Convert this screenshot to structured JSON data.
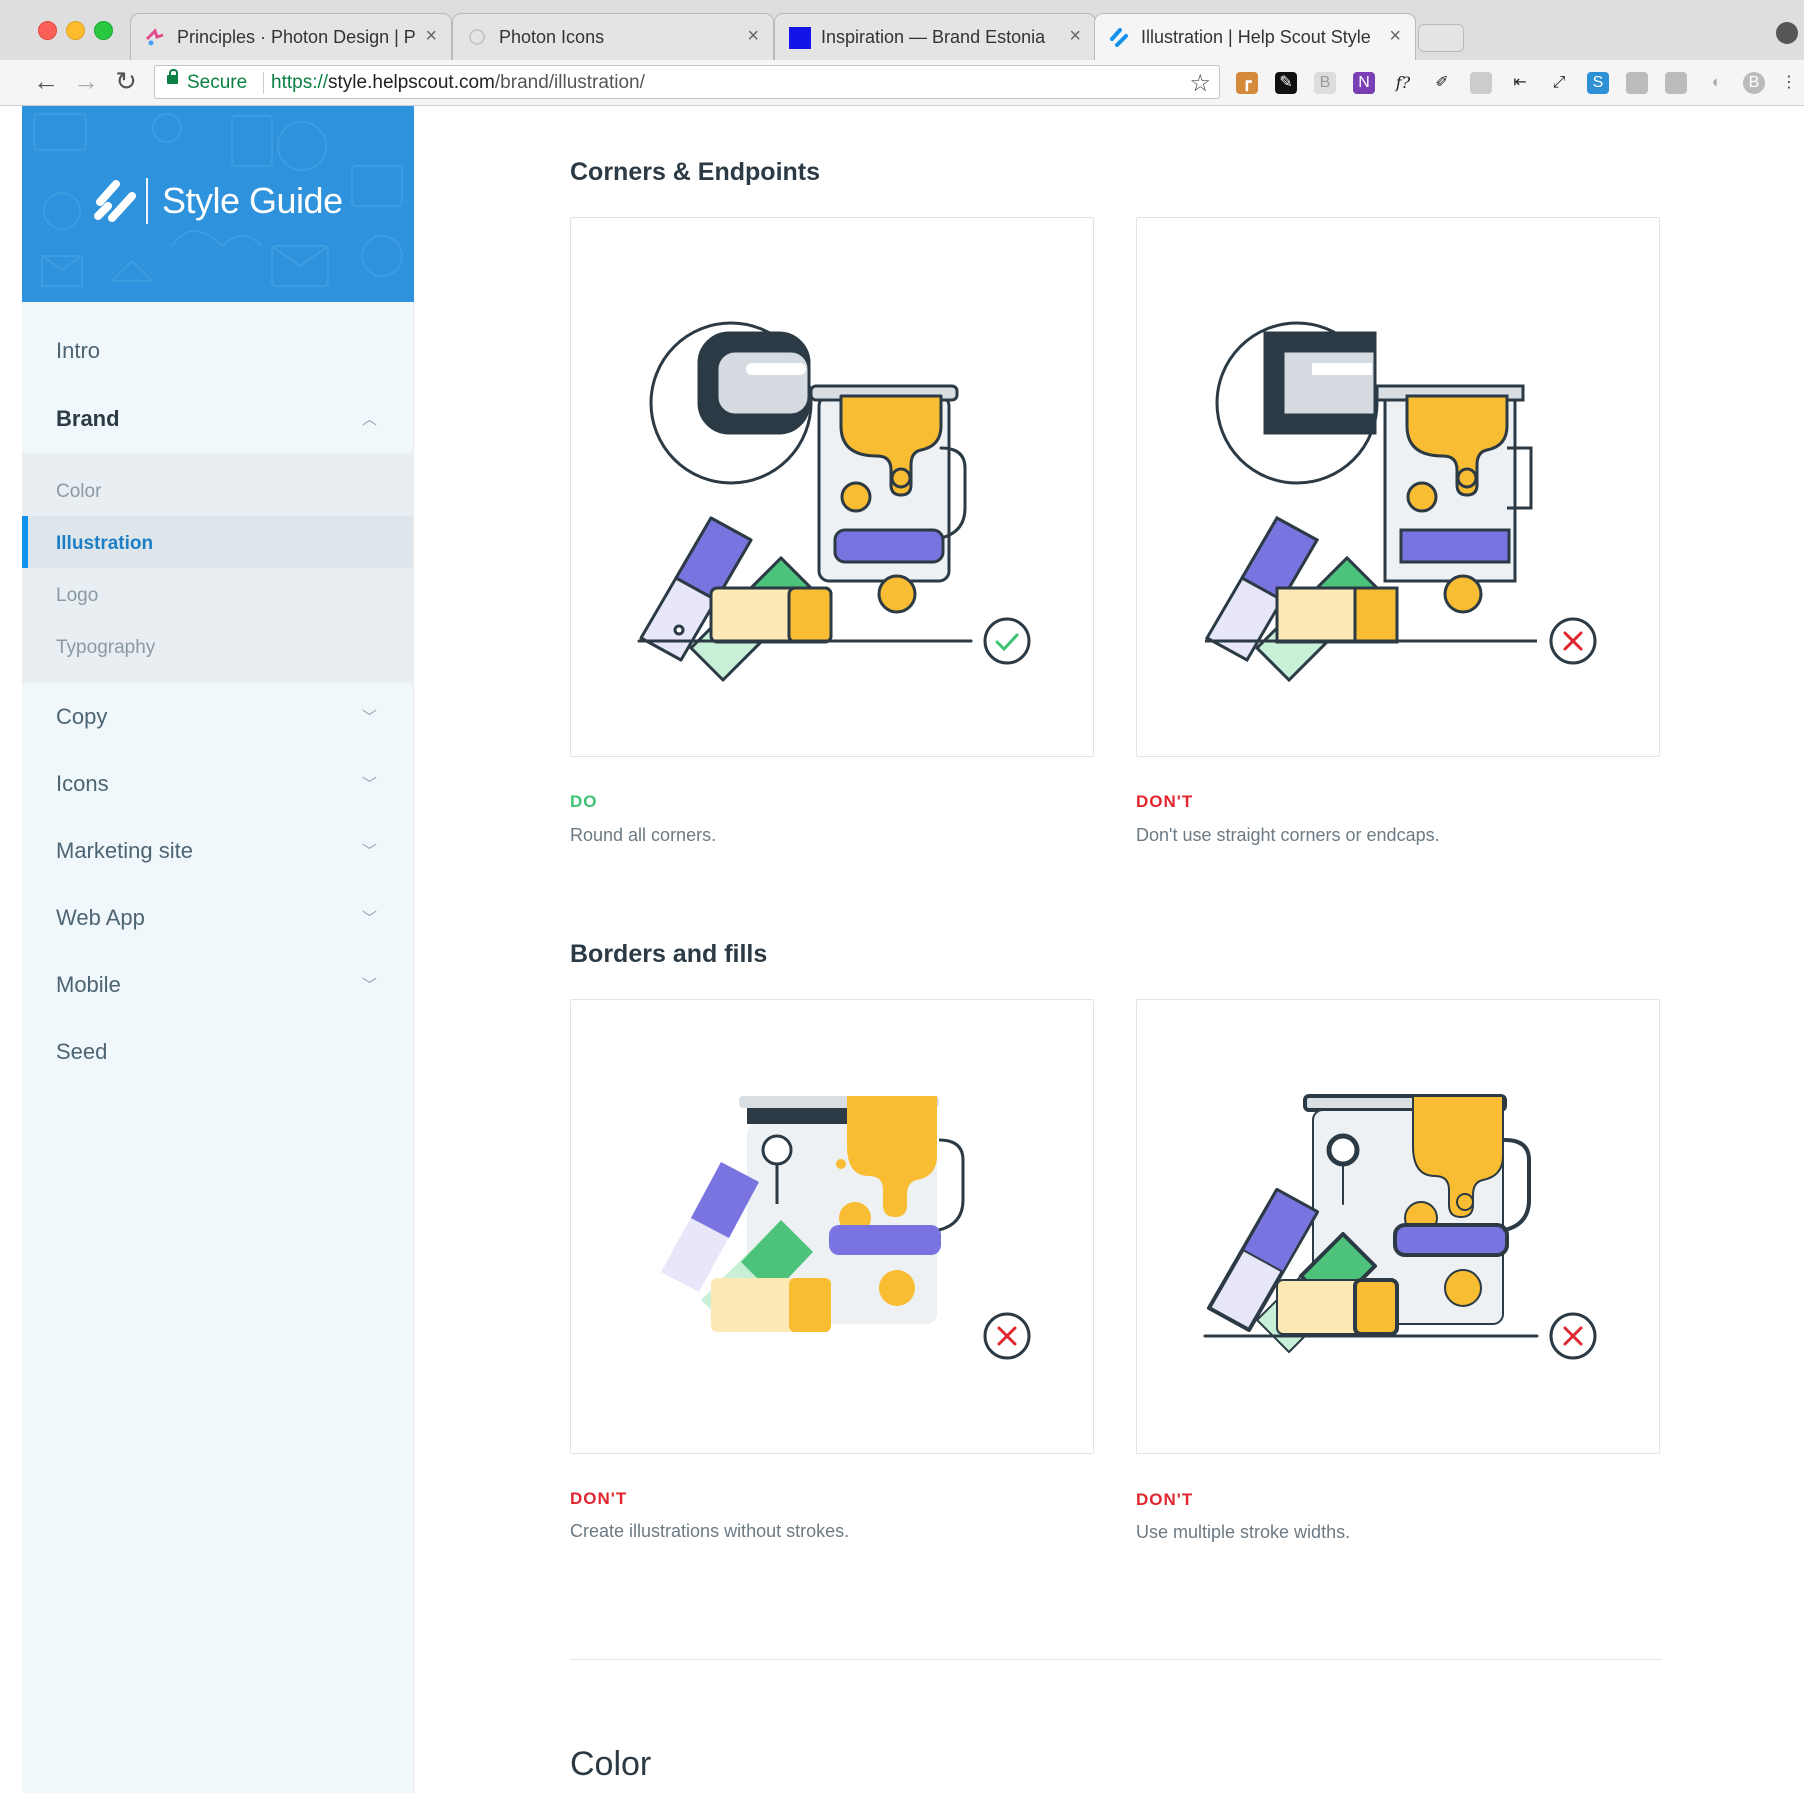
{
  "browser": {
    "tabs": [
      {
        "title": "Principles · Photon Design | Ph",
        "active": false
      },
      {
        "title": "Photon Icons",
        "active": false
      },
      {
        "title": "Inspiration — Brand Estonia",
        "active": false
      },
      {
        "title": "Illustration | Help Scout Style G",
        "active": true
      }
    ],
    "address": {
      "secure_label": "Secure",
      "scheme": "https://",
      "host": "style.helpscout.com",
      "path": "/brand/illustration/"
    }
  },
  "sidebar": {
    "title": "Style Guide",
    "items": [
      {
        "label": "Intro",
        "expanded": false
      },
      {
        "label": "Brand",
        "expanded": true,
        "children": [
          {
            "label": "Color"
          },
          {
            "label": "Illustration",
            "active": true
          },
          {
            "label": "Logo"
          },
          {
            "label": "Typography"
          }
        ]
      },
      {
        "label": "Copy",
        "expanded": false
      },
      {
        "label": "Icons",
        "expanded": false
      },
      {
        "label": "Marketing site",
        "expanded": false
      },
      {
        "label": "Web App",
        "expanded": false
      },
      {
        "label": "Mobile",
        "expanded": false
      },
      {
        "label": "Seed",
        "expanded": false
      }
    ]
  },
  "main": {
    "sections": [
      {
        "title": "Corners & Endpoints",
        "examples": [
          {
            "verdict": "DO",
            "text": "Round all corners."
          },
          {
            "verdict": "DON'T",
            "text": "Don't use straight corners or endcaps."
          }
        ]
      },
      {
        "title": "Borders and fills",
        "examples": [
          {
            "verdict": "DON'T",
            "text": "Create illustrations without strokes."
          },
          {
            "verdict": "DON'T",
            "text": "Use multiple stroke widths."
          }
        ]
      }
    ],
    "next_section_title": "Color"
  },
  "colors": {
    "brand_blue": "#2e92dc",
    "do_green": "#3ec274",
    "dont_red": "#e0272f",
    "paint_yellow": "#f8bd32",
    "swatch_purple": "#7a74e0",
    "swatch_green": "#4cc27a"
  }
}
